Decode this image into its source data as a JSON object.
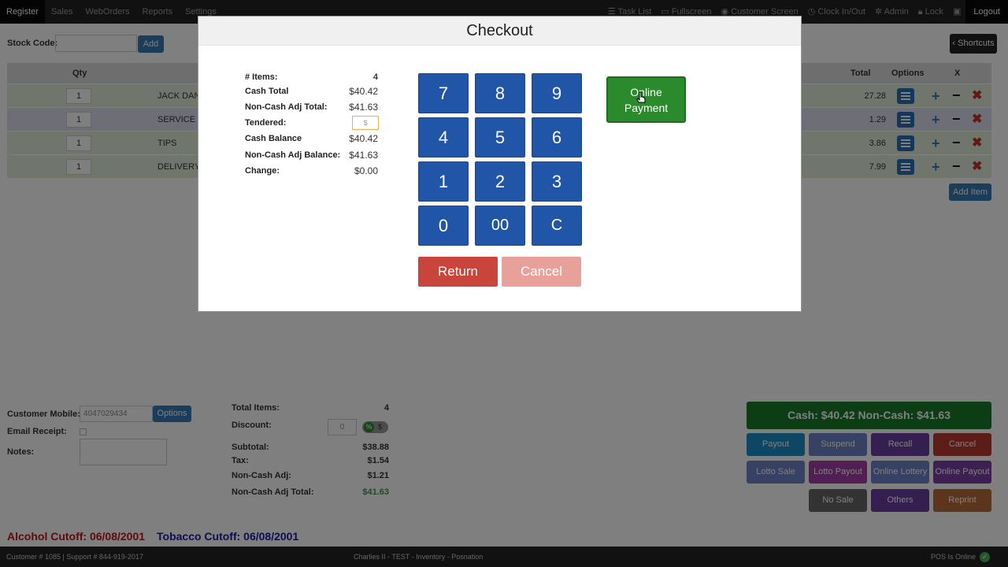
{
  "nav": {
    "left": [
      "Register",
      "Sales",
      "WebOrders",
      "Reports",
      "Settings"
    ],
    "right": [
      {
        "icon": "list-icon",
        "label": "Task List"
      },
      {
        "icon": "monitor-icon",
        "label": "Fullscreen"
      },
      {
        "icon": "eye-icon",
        "label": "Customer Screen"
      },
      {
        "icon": "clock-icon",
        "label": "Clock In/Out"
      },
      {
        "icon": "gear-icon",
        "label": "Admin"
      },
      {
        "icon": "lock-icon",
        "label": "Lock"
      },
      {
        "icon": "screen-icon",
        "label": ""
      }
    ],
    "logout": "Logout"
  },
  "stock": {
    "label": "Stock Code:",
    "add": "Add",
    "shortcuts": "Shortcuts"
  },
  "table": {
    "headers": {
      "qty": "Qty",
      "total": "Total",
      "options": "Options",
      "x": "X"
    },
    "rows": [
      {
        "qty": "1",
        "name": "JACK DAN",
        "total": "27.28",
        "color": "#e2ecd9"
      },
      {
        "qty": "1",
        "name": "SERVICE C",
        "total": "1.29",
        "color": "#dcdcef"
      },
      {
        "qty": "1",
        "name": "TIPS",
        "total": "3.86",
        "color": "#e2ecd9"
      },
      {
        "qty": "1",
        "name": "DELIVERY",
        "total": "7.99",
        "color": "#e2ecd9"
      }
    ],
    "add_item": "Add Item"
  },
  "customer": {
    "mobile_label": "Customer Mobile:",
    "mobile_value": "4047029434",
    "options": "Options",
    "email_label": "Email Receipt:",
    "notes_label": "Notes:"
  },
  "totals": {
    "items_label": "Total Items:",
    "items": "4",
    "discount_label": "Discount:",
    "discount_value": "0",
    "pct": "%",
    "dollar": "$",
    "subtotal_label": "Subtotal:",
    "subtotal": "$38.88",
    "tax_label": "Tax:",
    "tax": "$1.54",
    "noncash_adj_label": "Non-Cash Adj:",
    "noncash_adj": "$1.21",
    "noncash_total_label": "Non-Cash Adj Total:",
    "noncash_total": "$41.63"
  },
  "actions": {
    "banner": "Cash: $40.42   Non-Cash: $41.63",
    "buttons": [
      {
        "label": "Payout",
        "color": "#1d8fc9"
      },
      {
        "label": "Suspend",
        "color": "#6f83c8"
      },
      {
        "label": "Recall",
        "color": "#6b3fa0"
      },
      {
        "label": "Cancel",
        "color": "#b93a32"
      },
      {
        "label": "Lotto Sale",
        "color": "#6f83c8"
      },
      {
        "label": "Lotto Payout",
        "color": "#a33ea8"
      },
      {
        "label": "Online Lottery",
        "color": "#6f83c8"
      },
      {
        "label": "Online Payout",
        "color": "#7a3fa8"
      },
      {
        "label": "No Sale",
        "color": "#666666"
      },
      {
        "label": "Others",
        "color": "#6b3fa0"
      },
      {
        "label": "Reprint",
        "color": "#b86a3a"
      }
    ]
  },
  "cutoffs": {
    "alcohol": "Alcohol Cutoff: 06/08/2001",
    "tobacco": "Tobacco Cutoff: 06/08/2001"
  },
  "footer": {
    "left": "Customer # 1085 | Support # 844-919-2017",
    "center": "Charlies II - TEST - Inventory - Posnation",
    "right": "POS Is Online"
  },
  "checkout": {
    "title": "Checkout",
    "summary": [
      {
        "label": "# Items:",
        "value": "4"
      },
      {
        "label": "Cash Total",
        "value": "$40.42"
      },
      {
        "label": "Non-Cash Adj Total:",
        "value": "$41.63"
      },
      {
        "label": "Tendered:",
        "value": ""
      },
      {
        "label": "Cash Balance",
        "value": "$40.42"
      },
      {
        "label": "Non-Cash Adj Balance:",
        "value": "$41.63"
      },
      {
        "label": "Change:",
        "value": "$0.00"
      }
    ],
    "tendered_placeholder": "$",
    "keys": [
      "7",
      "8",
      "9",
      "4",
      "5",
      "6",
      "1",
      "2",
      "3",
      "0",
      "00",
      "C"
    ],
    "online_payment": "Online Payment",
    "return": "Return",
    "cancel": "Cancel"
  }
}
